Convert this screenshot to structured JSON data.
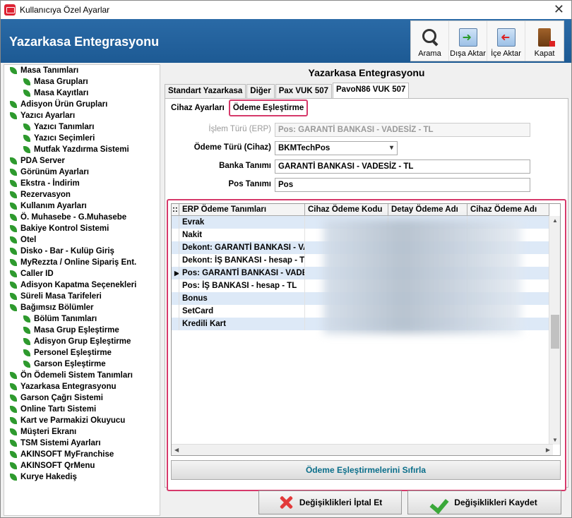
{
  "window": {
    "title": "Kullanıcıya Özel Ayarlar"
  },
  "header": {
    "title": "Yazarkasa Entegrasyonu",
    "toolbar": [
      {
        "label": "Arama",
        "icon": "search-icon"
      },
      {
        "label": "Dışa Aktar",
        "icon": "export-icon"
      },
      {
        "label": "İçe Aktar",
        "icon": "import-icon"
      },
      {
        "label": "Kapat",
        "icon": "close-door-icon"
      }
    ]
  },
  "sidebar": {
    "items": [
      {
        "label": "Masa Tanımları",
        "level": 1
      },
      {
        "label": "Masa Grupları",
        "level": 2
      },
      {
        "label": "Masa Kayıtları",
        "level": 2
      },
      {
        "label": "Adisyon Ürün Grupları",
        "level": 1
      },
      {
        "label": "Yazıcı Ayarları",
        "level": 1
      },
      {
        "label": "Yazıcı Tanımları",
        "level": 2
      },
      {
        "label": "Yazıcı Seçimleri",
        "level": 2
      },
      {
        "label": "Mutfak Yazdırma Sistemi",
        "level": 2
      },
      {
        "label": "PDA Server",
        "level": 1
      },
      {
        "label": "Görünüm Ayarları",
        "level": 1
      },
      {
        "label": "Ekstra - İndirim",
        "level": 1
      },
      {
        "label": "Rezervasyon",
        "level": 1
      },
      {
        "label": "Kullanım Ayarları",
        "level": 1
      },
      {
        "label": "Ö. Muhasebe - G.Muhasebe",
        "level": 1
      },
      {
        "label": "Bakiye Kontrol Sistemi",
        "level": 1
      },
      {
        "label": "Otel",
        "level": 1
      },
      {
        "label": "Disko - Bar - Kulüp Giriş",
        "level": 1
      },
      {
        "label": "MyRezzta / Online Sipariş Ent.",
        "level": 1
      },
      {
        "label": "Caller ID",
        "level": 1
      },
      {
        "label": "Adisyon Kapatma Seçenekleri",
        "level": 1
      },
      {
        "label": "Süreli Masa Tarifeleri",
        "level": 1
      },
      {
        "label": "Bağımsız Bölümler",
        "level": 1
      },
      {
        "label": "Bölüm Tanımları",
        "level": 2
      },
      {
        "label": "Masa Grup Eşleştirme",
        "level": 2
      },
      {
        "label": "Adisyon Grup Eşleştirme",
        "level": 2
      },
      {
        "label": "Personel Eşleştirme",
        "level": 2
      },
      {
        "label": "Garson Eşleştirme",
        "level": 2
      },
      {
        "label": "Ön Ödemeli Sistem Tanımları",
        "level": 1
      },
      {
        "label": "Yazarkasa Entegrasyonu",
        "level": 1
      },
      {
        "label": "Garson Çağrı Sistemi",
        "level": 1
      },
      {
        "label": "Online Tartı Sistemi",
        "level": 1
      },
      {
        "label": "Kart ve Parmakizi Okuyucu",
        "level": 1
      },
      {
        "label": "Müşteri Ekranı",
        "level": 1
      },
      {
        "label": "TSM Sistemi Ayarları",
        "level": 1
      },
      {
        "label": "AKINSOFT MyFranchise",
        "level": 1
      },
      {
        "label": "AKINSOFT QrMenu",
        "level": 1
      },
      {
        "label": "Kurye Hakediş",
        "level": 1
      }
    ]
  },
  "main": {
    "title": "Yazarkasa Entegrasyonu",
    "tabs": [
      {
        "label": "Standart Yazarkasa",
        "active": false
      },
      {
        "label": "Diğer",
        "active": false
      },
      {
        "label": "Pax VUK 507",
        "active": false
      },
      {
        "label": "PavoN86 VUK 507",
        "active": true
      }
    ],
    "subtabs": [
      {
        "label": "Cihaz Ayarları",
        "active": false
      },
      {
        "label": "Ödeme Eşleştirme",
        "active": true
      }
    ],
    "form": {
      "islem_turu": {
        "label": "İşlem Türü (ERP)",
        "value": "Pos: GARANTİ BANKASI - VADESİZ - TL"
      },
      "odeme_turu": {
        "label": "Ödeme Türü (Cihaz)",
        "value": "BKMTechPos"
      },
      "banka_tanimi": {
        "label": "Banka Tanımı",
        "value": "GARANTİ BANKASI - VADESİZ - TL"
      },
      "pos_tanimi": {
        "label": "Pos Tanımı",
        "value": "Pos"
      }
    },
    "grid": {
      "columns": [
        "ERP Ödeme Tanımları",
        "Cihaz Ödeme Kodu",
        "Detay Ödeme Adı",
        "Cihaz Ödeme Adı"
      ],
      "rows": [
        {
          "erp": "Evrak",
          "current": false
        },
        {
          "erp": "Nakit",
          "current": false
        },
        {
          "erp": "Dekont: GARANTİ BANKASI - VA",
          "current": false
        },
        {
          "erp": "Dekont: İŞ BANKASI - hesap - T",
          "current": false
        },
        {
          "erp": "Pos: GARANTİ BANKASI - VADES",
          "current": true
        },
        {
          "erp": "Pos: İŞ BANKASI - hesap - TL",
          "current": false
        },
        {
          "erp": "Bonus",
          "current": false
        },
        {
          "erp": "SetCard",
          "current": false
        },
        {
          "erp": "Kredili Kart",
          "current": false
        }
      ],
      "reset_label": "Ödeme Eşleştirmelerini Sıfırla"
    }
  },
  "footer": {
    "cancel_label": "Değişiklikleri İptal Et",
    "save_label": "Değişiklikleri Kaydet"
  }
}
